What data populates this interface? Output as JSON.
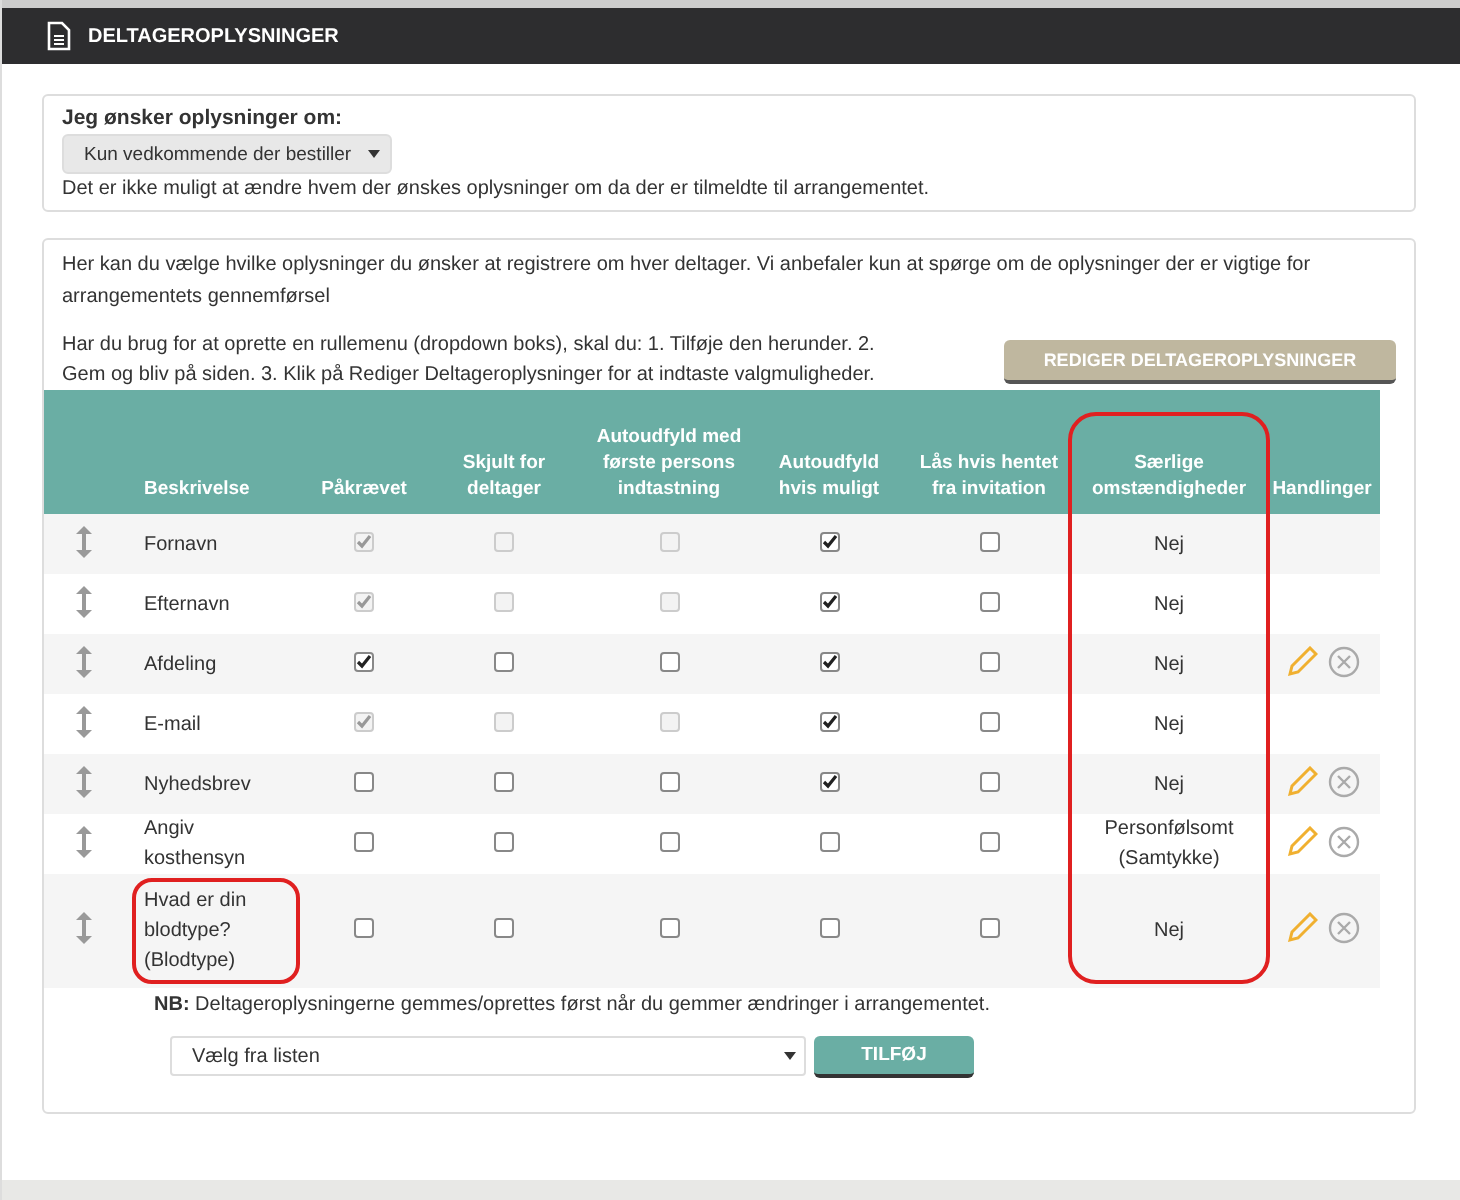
{
  "header": {
    "title": "DELTAGEROPLYSNINGER"
  },
  "info_panel": {
    "label": "Jeg ønsker oplysninger om:",
    "select_value": "Kun vedkommende der bestiller",
    "note": "Det er ikke muligt at ændre hvem der ønskes oplysninger om da der er tilmeldte til arrangementet."
  },
  "fields_panel": {
    "intro": "Her kan du vælge hvilke oplysninger du ønsker at registrere om hver deltager. Vi anbefaler kun at spørge om de oplysninger der er vigtige for arrangementets gennemførsel",
    "instructions": "Har du brug for at oprette en rullemenu (dropdown boks), skal du: 1. Tilføje den herunder. 2. Gem og bliv på siden. 3. Klik på Rediger Deltageroplysninger for at indtaste valgmuligheder.",
    "edit_button": "REDIGER DELTAGEROPLYSNINGER"
  },
  "table": {
    "columns": [
      {
        "label": "Beskrivelse",
        "highlighted": false
      },
      {
        "label": "Påkrævet",
        "highlighted": false
      },
      {
        "label": "Skjult for deltager",
        "highlighted": false
      },
      {
        "label": "Autoudfyld med første persons indtastning",
        "highlighted": false
      },
      {
        "label": "Autoudfyld hvis muligt",
        "highlighted": false
      },
      {
        "label": "Lås hvis hentet fra invitation",
        "highlighted": false
      },
      {
        "label": "Særlige omstændigheder",
        "highlighted": true
      },
      {
        "label": "Handlinger",
        "highlighted": false
      }
    ],
    "rows": [
      {
        "description": "Fornavn",
        "highlighted": false,
        "checks": [
          {
            "checked": true,
            "disabled": true
          },
          {
            "checked": false,
            "disabled": true
          },
          {
            "checked": false,
            "disabled": true
          },
          {
            "checked": true,
            "disabled": false
          },
          {
            "checked": false,
            "disabled": false
          }
        ],
        "special": "Nej",
        "actions": false
      },
      {
        "description": "Efternavn",
        "highlighted": false,
        "checks": [
          {
            "checked": true,
            "disabled": true
          },
          {
            "checked": false,
            "disabled": true
          },
          {
            "checked": false,
            "disabled": true
          },
          {
            "checked": true,
            "disabled": false
          },
          {
            "checked": false,
            "disabled": false
          }
        ],
        "special": "Nej",
        "actions": false
      },
      {
        "description": "Afdeling",
        "highlighted": false,
        "checks": [
          {
            "checked": true,
            "disabled": false
          },
          {
            "checked": false,
            "disabled": false
          },
          {
            "checked": false,
            "disabled": false
          },
          {
            "checked": true,
            "disabled": false
          },
          {
            "checked": false,
            "disabled": false
          }
        ],
        "special": "Nej",
        "actions": true
      },
      {
        "description": "E-mail",
        "highlighted": false,
        "checks": [
          {
            "checked": true,
            "disabled": true
          },
          {
            "checked": false,
            "disabled": true
          },
          {
            "checked": false,
            "disabled": true
          },
          {
            "checked": true,
            "disabled": false
          },
          {
            "checked": false,
            "disabled": false
          }
        ],
        "special": "Nej",
        "actions": false
      },
      {
        "description": "Nyhedsbrev",
        "highlighted": false,
        "checks": [
          {
            "checked": false,
            "disabled": false
          },
          {
            "checked": false,
            "disabled": false
          },
          {
            "checked": false,
            "disabled": false
          },
          {
            "checked": true,
            "disabled": false
          },
          {
            "checked": false,
            "disabled": false
          }
        ],
        "special": "Nej",
        "actions": true
      },
      {
        "description": "Angiv kosthensyn",
        "highlighted": false,
        "checks": [
          {
            "checked": false,
            "disabled": false
          },
          {
            "checked": false,
            "disabled": false
          },
          {
            "checked": false,
            "disabled": false
          },
          {
            "checked": false,
            "disabled": false
          },
          {
            "checked": false,
            "disabled": false
          }
        ],
        "special": "Personfølsomt (Samtykke)",
        "actions": true
      },
      {
        "description": "Hvad er din blodtype? (Blodtype)",
        "highlighted": true,
        "checks": [
          {
            "checked": false,
            "disabled": false
          },
          {
            "checked": false,
            "disabled": false
          },
          {
            "checked": false,
            "disabled": false
          },
          {
            "checked": false,
            "disabled": false
          },
          {
            "checked": false,
            "disabled": false
          }
        ],
        "special": "Nej",
        "actions": true
      }
    ]
  },
  "note": "**NB:** Deltageroplysningerne gemmes/oprettes først når du gemmer ændringer i arrangementet.",
  "add": {
    "select_value": "Vælg fra listen",
    "button": "TILFØJ"
  }
}
